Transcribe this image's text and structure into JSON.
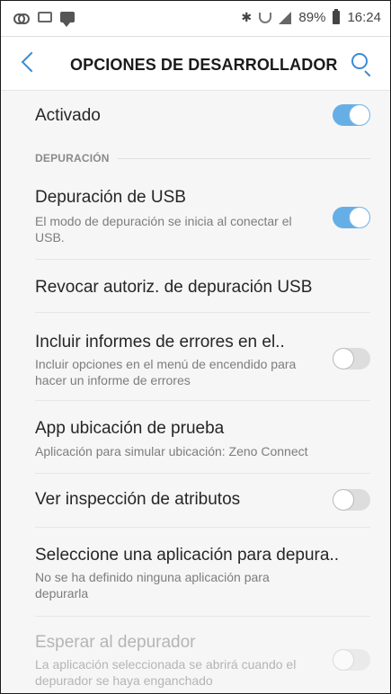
{
  "status_bar": {
    "battery_pct": "89%",
    "time": "16:24",
    "icons": [
      "link-icon",
      "image-icon",
      "chat-icon",
      "bluetooth-icon",
      "wifi-icon",
      "signal-icon",
      "battery-icon"
    ]
  },
  "header": {
    "title": "OPCIONES DE DESARROLLADOR",
    "back_icon": "back-arrow-icon",
    "search_icon": "search-icon"
  },
  "main_toggle": {
    "label": "Activado",
    "state": "on"
  },
  "section": {
    "title": "DEPURACIÓN"
  },
  "items": [
    {
      "label": "Depuración de USB",
      "sub": "El modo de depuración se inicia al conectar el USB.",
      "toggle": "on"
    },
    {
      "label": "Revocar autoriz. de depuración USB",
      "sub": "",
      "toggle": "none"
    },
    {
      "label": "Incluir informes de errores en el..",
      "sub": "Incluir opciones en el menú de encendido para hacer un informe de errores",
      "toggle": "off"
    },
    {
      "label": "App ubicación de prueba",
      "sub": "Aplicación para simular ubicación: Zeno Connect",
      "toggle": "none"
    },
    {
      "label": "Ver inspección de atributos",
      "sub": "",
      "toggle": "off"
    },
    {
      "label": "Seleccione una aplicación para depura..",
      "sub": "No se ha definido ninguna aplicación para depurarla",
      "toggle": "none"
    },
    {
      "label": "Esperar al depurador",
      "sub": "La aplicación seleccionada se abrirá cuando el depurador se haya enganchado",
      "toggle": "off-disabled"
    }
  ],
  "colors": {
    "accent": "#3b8bd6",
    "toggle_on": "#66afe6",
    "background": "#f6f6f6"
  }
}
